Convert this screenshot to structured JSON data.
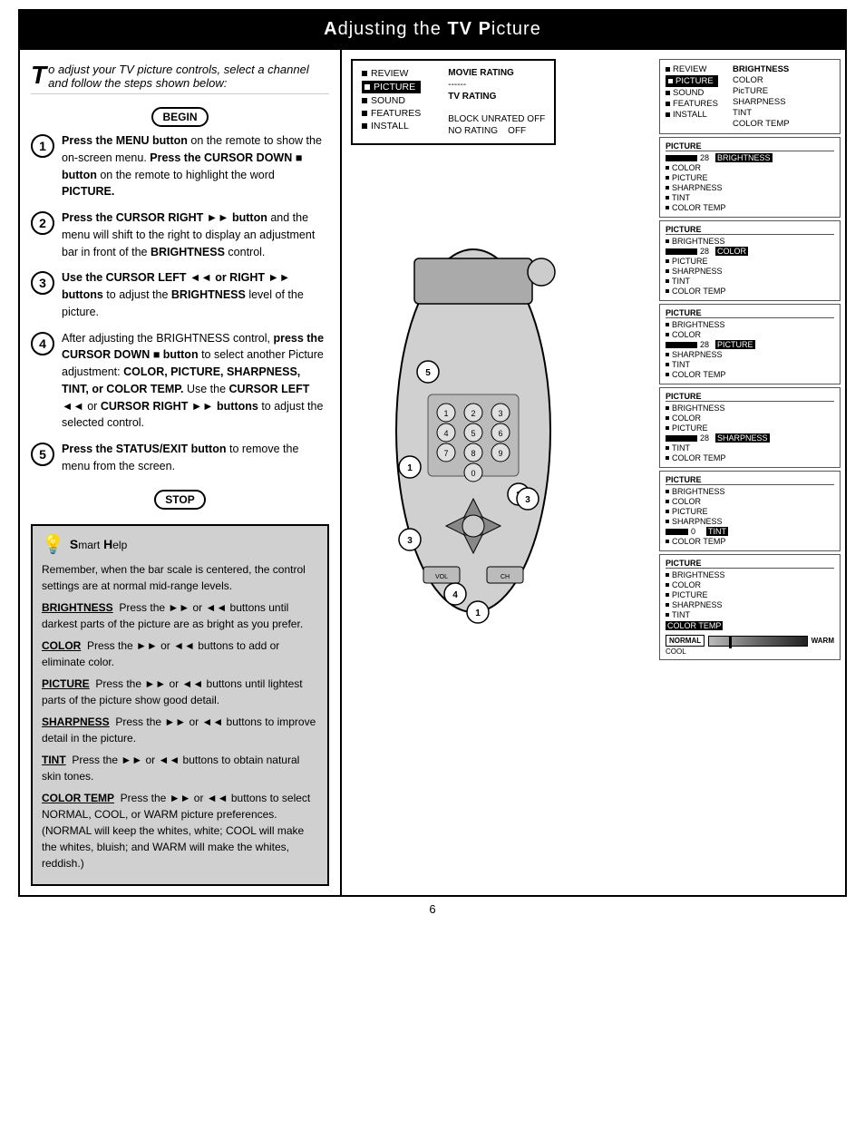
{
  "header": {
    "title": "Adjusting the TV Picture",
    "title_parts": [
      "Adjusting the ",
      "TV",
      " Picture"
    ]
  },
  "intro": {
    "text": "o adjust your TV picture controls, select a channel and follow the steps shown below:",
    "drop_cap": "T"
  },
  "begin_label": "BEGIN",
  "stop_label": "STOP",
  "steps": [
    {
      "num": "1",
      "text": "Press the MENU button on the remote to show the on-screen menu. Press the CURSOR DOWN ■ button on the remote to highlight the word PICTURE."
    },
    {
      "num": "2",
      "text": "Press the CURSOR RIGHT ►► button and the menu will shift to the right to display an adjustment bar in front of the BRIGHTNESS control."
    },
    {
      "num": "3",
      "text": "Use the CURSOR LEFT ◄◄ or RIGHT ►► buttons to adjust the BRIGHTNESS level of the picture."
    },
    {
      "num": "4",
      "text": "After adjusting the BRIGHTNESS control, press the CURSOR DOWN ■ button to select another Picture adjustment: COLOR, PICTURE, SHARPNESS, TINT, or COLOR TEMP. Use the CURSOR LEFT ◄◄ or CURSOR RIGHT ►► buttons to adjust the selected control."
    },
    {
      "num": "5",
      "text": "Press the STATUS/EXIT button to remove the menu from the screen."
    }
  ],
  "smart_help": {
    "title": "Smart Help",
    "intro": "Remember, when the bar scale is centered, the control settings are at normal mid-range levels.",
    "items": [
      {
        "label": "BRIGHTNESS",
        "text": "Press the ►► or ◄◄ buttons until darkest parts of the picture are as bright as you prefer."
      },
      {
        "label": "COLOR",
        "text": "Press the ►► or ◄◄ buttons to add or eliminate color."
      },
      {
        "label": "PICTURE",
        "text": "Press the ►► or ◄◄ buttons until lightest parts of the picture show good detail."
      },
      {
        "label": "SHARPNESS",
        "text": "Press the ►► or ◄◄ buttons to improve detail in the picture."
      },
      {
        "label": "TINT",
        "text": "Press the ►► or ◄◄ buttons to obtain natural skin tones."
      },
      {
        "label": "COLOR TEMP",
        "text": "Press the ►► or ◄◄ buttons to select NORMAL, COOL, or WARM picture preferences. (NORMAL will keep the whites, white; COOL will make the whites, bluish; and WARM will make the whites, reddish.)"
      }
    ]
  },
  "first_menu": {
    "items": [
      "REVIEW",
      "PICTURE",
      "SOUND",
      "FEATURES",
      "INSTALL"
    ],
    "right_items": [
      "MOVIE RATING",
      "------",
      "TV RATING",
      "",
      "BLOCK UNRATED OFF",
      "NO RATING    OFF"
    ]
  },
  "second_menu": {
    "title": "",
    "items": [
      "REVIEW",
      "PICTURE",
      "SOUND",
      "FEATURES",
      "INSTALL"
    ],
    "sub_items": [
      "BRIGHTNESS",
      "COLOR",
      "PICTURE",
      "SHARPNESS",
      "TINT",
      "COLOR TEMP"
    ]
  },
  "cascade_menus": [
    {
      "title": "PICTURE",
      "value": "28",
      "active": "BRIGHTNESS",
      "items": [
        "BRIGHTNESS",
        "COLOR",
        "PICTURE",
        "SHARPNESS",
        "TINT",
        "COLOR TEMP"
      ]
    },
    {
      "title": "PICTURE",
      "value": "28",
      "active": "COLOR",
      "items": [
        "BRIGHTNESS",
        "COLOR",
        "PICTURE",
        "SHARPNESS",
        "TINT",
        "COLOR TEMP"
      ]
    },
    {
      "title": "PICTURE",
      "value": "28",
      "active": "PICTURE",
      "items": [
        "BRIGHTNESS",
        "COLOR",
        "PICTURE",
        "SHARPNESS",
        "TINT",
        "COLOR TEMP"
      ]
    },
    {
      "title": "PICTURE",
      "value": "28",
      "active": "SHARPNESS",
      "items": [
        "BRIGHTNESS",
        "COLOR",
        "PICTURE",
        "SHARPNESS",
        "TINT",
        "COLOR TEMP"
      ]
    },
    {
      "title": "PICTURE",
      "value": "0",
      "active": "TINT",
      "items": [
        "BRIGHTNESS",
        "COLOR",
        "PICTURE",
        "SHARPNESS",
        "TINT",
        "COLOR TEMP"
      ]
    },
    {
      "title": "PICTURE",
      "value": "",
      "active": "COLOR TEMP",
      "items": [
        "BRIGHTNESS",
        "COLOR",
        "PICTURE",
        "SHARPNESS",
        "TINT",
        "COLOR TEMP"
      ],
      "colortemp": true,
      "normal_label": "NORMAL",
      "cool_label": "COOL",
      "warm_label": "WARM"
    }
  ],
  "page_number": "6",
  "step_labels_on_diagram": [
    "1",
    "2",
    "3",
    "4",
    "5"
  ]
}
